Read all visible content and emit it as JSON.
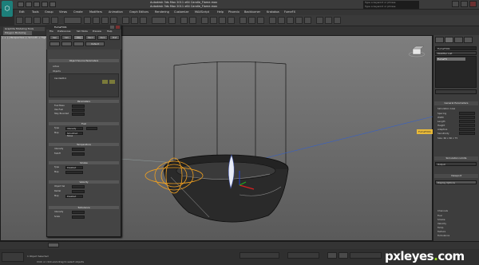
{
  "window": {
    "title_line_1": "Autodesk 3ds Max 2011 x64 Candle_Flame.max",
    "title_line_2": "Autodesk 3ds Max 2011 x64 Candle_Flame.max",
    "search_placeholder_1": "Type a keyword or phrase",
    "search_placeholder_2": "Type a keyword or phrase"
  },
  "menubar": {
    "items": [
      "Edit",
      "Tools",
      "Group",
      "Views",
      "Create",
      "Modifiers",
      "Animation",
      "Graph Editors",
      "Rendering",
      "Customize",
      "MAXScript",
      "Help",
      "Phoenix",
      "Backburner",
      "Krakatoa",
      "FumeFX"
    ]
  },
  "ribbon": {
    "tab_main": "Graphite Modeling Tools",
    "tab_sub": "Polygon Modeling"
  },
  "viewport": {
    "label": "[ + ] [ Perspective ] [ Smooth + Highlights ]",
    "tag": "FumeFX01"
  },
  "fumefx": {
    "title": "FumeFX01",
    "menu": [
      "File",
      "Preferences",
      "Sim Mode",
      "Preview",
      "Help"
    ],
    "tabs": [
      "Gen",
      "Sim",
      "Obj",
      "Rend",
      "Illum",
      "Pref"
    ],
    "top_button": "Default",
    "object_source_header": "Object Source Parameters",
    "active_label": "Active",
    "objects_label": "Objects",
    "objects_list_item": "CandleWick",
    "params_header": "Parameters",
    "param_rows": [
      "Fuel Mass",
      "Use Fuel",
      "Stay Bounded"
    ],
    "fuel_header": "Fuel",
    "fuel_type": "Type",
    "fuel_map": "Map",
    "fuel_type_value": "Intensity",
    "fuel_map_value": "Smoothed Noise",
    "temp_header": "Temperature",
    "temp_fields": [
      "Intensity",
      "Falloff"
    ],
    "smoke_header": "Smoke",
    "smoke_fields": [
      "Type",
      "Map"
    ],
    "velocity_header": "Velocity",
    "velocity_fields": [
      "Object Vel",
      "Radial",
      "Map"
    ],
    "turb_header": "Turbulence",
    "turb_fields": [
      "Intensity",
      "Scale"
    ],
    "disabled_value": "Disabled"
  },
  "command_panel": {
    "object_name": "FumeFX01",
    "modifier_list_label": "Modifier List",
    "stack_item": "FumeFX",
    "general_params": "General Parameters",
    "simulation_area": "Simulation Area",
    "fields": [
      "Spacing",
      "Width",
      "Length",
      "Height",
      "Adaptive",
      "Sensitivity"
    ],
    "size_label": "Size: 60 x 60 x 75",
    "simulation_section": "Simulation Limits",
    "output_section": "Output",
    "viewport_section": "Viewport",
    "display_options": "Display Options",
    "channels_label": "Channels",
    "channels": [
      "Fuel",
      "Smoke",
      "Velocity",
      "Temp",
      "Texture",
      "Turbulence"
    ]
  },
  "status": {
    "selected_text": "1 Object Selected",
    "prompt_text": "Click or click-and-drag to select objects",
    "watermark_main": "pxleyes",
    "watermark_dot": ".",
    "watermark_tld": "com"
  },
  "colors": {
    "accent_orange": "#e8b93a",
    "selection_orange": "#f0a020",
    "wire_black": "#151515",
    "watermark_green": "#9be021"
  }
}
